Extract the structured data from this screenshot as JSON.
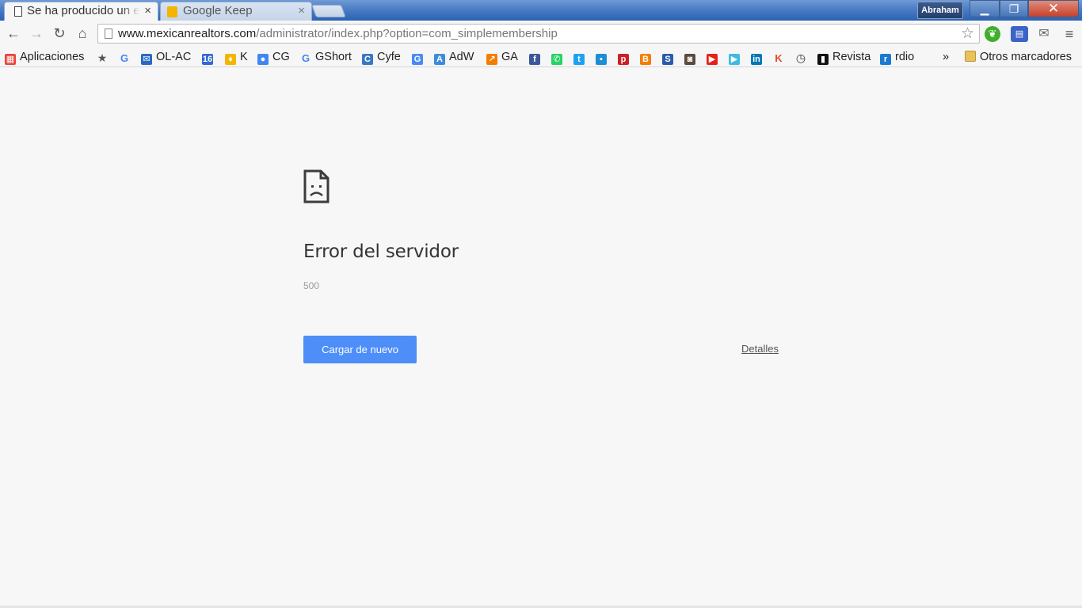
{
  "browser": {
    "tabs": [
      {
        "label": "Se ha producido un e",
        "icon": "document-icon",
        "active": true
      },
      {
        "label": "Google Keep",
        "icon": "keep-icon",
        "active": false
      }
    ],
    "close_glyph": "×",
    "profile_name": "Abraham",
    "window_controls": {
      "minimize": "▁",
      "maximize": "❐",
      "close": "✕"
    }
  },
  "toolbar": {
    "back": "←",
    "forward": "→",
    "reload": "↻",
    "home": "⌂",
    "url_host": "www.mexicanrealtors.com",
    "url_path": "/administrator/index.php?option=com_simplemembership",
    "star": "☆",
    "menu": "≡"
  },
  "bookmarks": {
    "items": [
      {
        "label": "Aplicaciones",
        "icon": "apps-grid-icon",
        "color": "#e8453c"
      },
      {
        "label": "",
        "icon": "star-icon",
        "color": "#555555"
      },
      {
        "label": "",
        "icon": "google-icon",
        "color": "#4285f4"
      },
      {
        "label": "OL-AC",
        "icon": "mail-icon",
        "color": "#2a6ac2"
      },
      {
        "label": "",
        "icon": "calendar-icon",
        "color": "#3367d6"
      },
      {
        "label": "K",
        "icon": "keep-icon",
        "color": "#f4b400"
      },
      {
        "label": "CG",
        "icon": "contacts-icon",
        "color": "#4285f4"
      },
      {
        "label": "GShort",
        "icon": "google-icon",
        "color": "#4285f4"
      },
      {
        "label": "Cyfe",
        "icon": "cyfe-icon",
        "color": "#3a78c3"
      },
      {
        "label": "",
        "icon": "translate-icon",
        "color": "#4a8af4"
      },
      {
        "label": "AdW",
        "icon": "adwords-icon",
        "color": "#3c8cdc"
      },
      {
        "label": "GA",
        "icon": "analytics-icon",
        "color": "#f57c00"
      },
      {
        "label": "",
        "icon": "facebook-icon",
        "color": "#3b5998"
      },
      {
        "label": "",
        "icon": "whatsapp-icon",
        "color": "#25d366"
      },
      {
        "label": "",
        "icon": "twitter-icon",
        "color": "#1da1f2"
      },
      {
        "label": "",
        "icon": "tweetdeck-icon",
        "color": "#1d8dd6"
      },
      {
        "label": "",
        "icon": "pinterest-icon",
        "color": "#cb2027"
      },
      {
        "label": "",
        "icon": "blogger-icon",
        "color": "#f57d00"
      },
      {
        "label": "",
        "icon": "shazam-icon",
        "color": "#2a5caa"
      },
      {
        "label": "",
        "icon": "instagram-icon",
        "color": "#5b4a3e"
      },
      {
        "label": "",
        "icon": "youtube-icon",
        "color": "#e62117"
      },
      {
        "label": "",
        "icon": "play-icon",
        "color": "#3fbbe1"
      },
      {
        "label": "",
        "icon": "linkedin-icon",
        "color": "#0077b5"
      },
      {
        "label": "",
        "icon": "klout-icon",
        "color": "#e44c24"
      },
      {
        "label": "",
        "icon": "timer-icon",
        "color": "#333333"
      },
      {
        "label": "Revista",
        "icon": "revista-icon",
        "color": "#111111"
      },
      {
        "label": "rdio",
        "icon": "rdio-icon",
        "color": "#1a7ad2"
      }
    ],
    "overflow": "»",
    "other": {
      "label": "Otros marcadores",
      "icon": "folder-icon"
    }
  },
  "error": {
    "title": "Error del servidor",
    "code": "500",
    "reload_button": "Cargar de nuevo",
    "details_link": "Detalles"
  },
  "colors": {
    "accent": "#4d8ef8",
    "page_background": "#f7f7f7"
  }
}
